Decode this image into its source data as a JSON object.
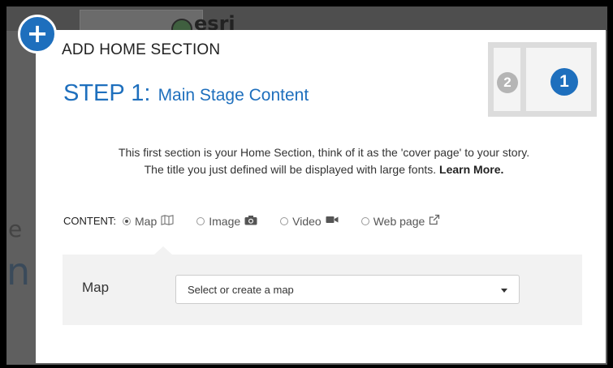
{
  "background": {
    "logo_text": "esri",
    "side_letters": [
      "e",
      "n"
    ]
  },
  "dialog": {
    "title": "ADD HOME SECTION",
    "add_badge": "+",
    "step_number": "STEP 1:",
    "step_subtitle": "Main Stage Content",
    "layout_thumb": {
      "secondary": "2",
      "primary": "1"
    },
    "description_line1": "This first section is your Home Section, think of it as the 'cover page' to your story.",
    "description_line2": "The title you just defined will be displayed with large fonts.",
    "learn_more": "Learn More.",
    "content_label": "CONTENT:",
    "content_options": [
      {
        "label": "Map",
        "icon": "map-icon",
        "selected": true
      },
      {
        "label": "Image",
        "icon": "camera-icon",
        "selected": false
      },
      {
        "label": "Video",
        "icon": "video-camera-icon",
        "selected": false
      },
      {
        "label": "Web page",
        "icon": "external-link-icon",
        "selected": false
      }
    ],
    "map_field": {
      "label": "Map",
      "placeholder": "Select or create a map"
    }
  },
  "colors": {
    "accent": "#1e6fbd",
    "thumb_inactive": "#b5b5b5",
    "panel_bg": "#f2f2f2"
  }
}
